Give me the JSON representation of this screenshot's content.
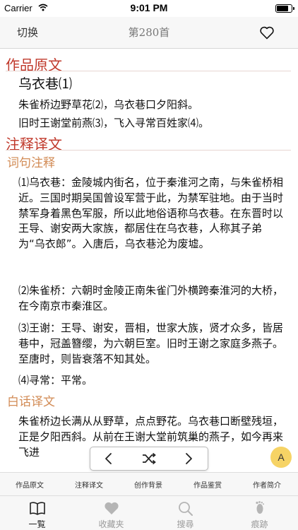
{
  "status": {
    "carrier": "Carrier",
    "time": "9:01 PM",
    "battery_level": 0.9
  },
  "nav": {
    "switch_label": "切换",
    "title": "第280首"
  },
  "sections": {
    "original": {
      "heading": "作品原文",
      "poem_title": "乌衣巷⑴",
      "lines": [
        "朱雀桥边野草花⑵，乌衣巷口夕阳斜。",
        "旧时王谢堂前燕⑶，飞入寻常百姓家⑷。"
      ]
    },
    "annotation": {
      "heading": "注释译文",
      "notes_heading": "词句注释",
      "notes": [
        "⑴乌衣巷：金陵城内街名，位于秦淮河之南，与朱雀桥相近。三国时期吴国曾设军营于此，为禁军驻地。由于当时禁军身着黑色军服，所以此地俗语称乌衣巷。在东晋时以王导、谢安两大家族，都居住在乌衣巷，人称其子弟为“乌衣郎”。入唐后，乌衣巷沦为废墟。",
        "⑵朱雀桥：六朝时金陵正南朱雀门外横跨秦淮河的大桥，在今南京市秦淮区。",
        "⑶王谢：王导、谢安，晋相，世家大族，贤才众多，皆居巷中，冠盖簪缨，为六朝巨室。旧时王谢之家庭多燕子。至唐时，则皆衰落不知其处。",
        "⑷寻常：平常。"
      ],
      "translation_heading": "白话译文",
      "translation": "朱雀桥边长满从从野草，点点野花。乌衣巷口断壁残垣，正是夕阳西斜。从前在王谢大堂前筑巢的燕子，如今再来飞进"
    }
  },
  "font_button": "A",
  "segments": [
    "作品原文",
    "注释译文",
    "创作背景",
    "作品鉴赏",
    "作者简介"
  ],
  "tabs": [
    {
      "label": "一覧",
      "icon": "book-icon",
      "active": true
    },
    {
      "label": "收藏夹",
      "icon": "heart-icon",
      "active": false
    },
    {
      "label": "搜尋",
      "icon": "search-icon",
      "active": false
    },
    {
      "label": "痕跡",
      "icon": "footprint-icon",
      "active": false
    }
  ],
  "colors": {
    "section_heading": "#c0392b",
    "sub_heading": "#d28b55",
    "font_button_bg": "#f6d365"
  }
}
